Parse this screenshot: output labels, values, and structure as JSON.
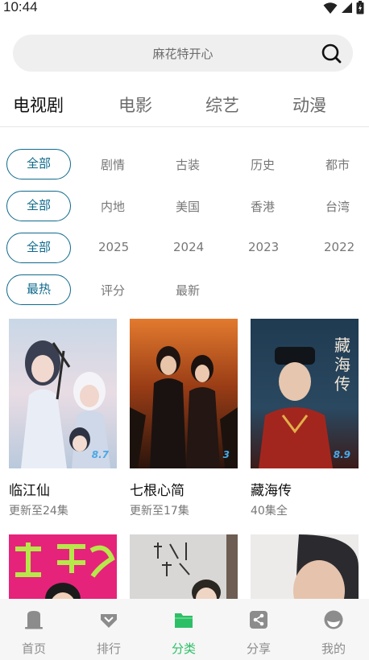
{
  "status_bar": {
    "time": "10:44"
  },
  "search": {
    "text": "麻花特开心"
  },
  "category_tabs": [
    {
      "label": "电视剧",
      "active": true
    },
    {
      "label": "电影",
      "active": false
    },
    {
      "label": "综艺",
      "active": false
    },
    {
      "label": "动漫",
      "active": false
    }
  ],
  "filters": {
    "genre": {
      "selected": "全部",
      "options": [
        "剧情",
        "古装",
        "历史",
        "都市"
      ]
    },
    "region": {
      "selected": "全部",
      "options": [
        "内地",
        "美国",
        "香港",
        "台湾"
      ]
    },
    "year": {
      "selected": "全部",
      "options": [
        "2025",
        "2024",
        "2023",
        "2022"
      ]
    },
    "sort": {
      "selected": "最热",
      "options": [
        "评分",
        "最新"
      ]
    }
  },
  "shows": [
    {
      "title": "临江仙",
      "subtitle": "更新至24集",
      "rating": "8.7"
    },
    {
      "title": "七根心简",
      "subtitle": "更新至17集",
      "rating": "3"
    },
    {
      "title": "藏海传",
      "subtitle": "40集全",
      "rating": "8.9"
    },
    {
      "title": "",
      "subtitle": "",
      "rating": ""
    },
    {
      "title": "",
      "subtitle": "",
      "rating": ""
    },
    {
      "title": "",
      "subtitle": "",
      "rating": ""
    }
  ],
  "bottom_nav": [
    {
      "label": "首页",
      "icon": "home-icon",
      "active": false
    },
    {
      "label": "排行",
      "icon": "ranking-icon",
      "active": false
    },
    {
      "label": "分类",
      "icon": "folder-icon",
      "active": true
    },
    {
      "label": "分享",
      "icon": "share-icon",
      "active": false
    },
    {
      "label": "我的",
      "icon": "profile-icon",
      "active": false
    }
  ],
  "colors": {
    "accent": "#0e6a8c",
    "nav_active": "#2dbf66",
    "nav_inactive": "#8c8c8c"
  }
}
